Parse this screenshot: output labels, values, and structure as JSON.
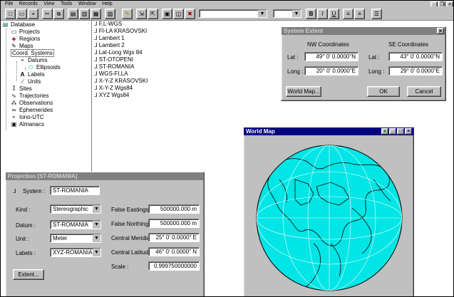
{
  "menu": [
    "File",
    "Records",
    "View",
    "Tools",
    "Window",
    "Help"
  ],
  "toolbar": {
    "buttons": [
      "new-icon",
      "open-icon",
      "save-icon",
      "cut-icon",
      "copy-icon",
      "paste-icon",
      "print-icon",
      "zoom-icon",
      "properties-icon",
      "edit-icon",
      "import-icon",
      "export-icon",
      "window-icon",
      "map-icon",
      "delete-icon",
      "bold-icon",
      "italic-icon",
      "underline-icon",
      "align-left-icon",
      "align-center-icon",
      "list-icon"
    ]
  },
  "tree": {
    "items": [
      "Database",
      "Projects",
      "Regions",
      "Maps",
      "Coord. Systems",
      "Datums",
      "Ellipsoids",
      "Labels",
      "Units",
      "Sites",
      "Trajectories",
      "Observations",
      "Ephemerides",
      "Iono-UTC",
      "Almanacs"
    ]
  },
  "coord_systems": [
    "F,L-WGS",
    "FI-LA KRASOVSKI",
    "Lambert 1",
    "Lambert 2",
    "Lat-Long Wgs 84",
    "ST-OTOPENI",
    "ST-ROMANIA",
    "WGS-FI,LA",
    "X-Y-Z KRASOVSKI",
    "X-Y-Z Wgs84",
    "XYZ Wgs84"
  ],
  "system_extent": {
    "title": "System Extent",
    "nw_header": "NW Coordinates",
    "se_header": "SE Coordinates",
    "lat_label": "Lat :",
    "long_label": "Long :",
    "nw_lat": "49° 0' 0.0000\"N",
    "nw_long": "20° 0' 0.0000\"E",
    "se_lat": "43° 0' 0.0000\"N",
    "se_long": "29° 0' 0.0000\"E",
    "world_map_btn": "World Map...",
    "ok_btn": "OK",
    "cancel_btn": "Cancel"
  },
  "world_map": {
    "title": "World Map"
  },
  "projection": {
    "title": "Projection [ST-ROMANIA]",
    "system_label": "System :",
    "system_value": "ST-ROMANIA",
    "kind_label": "Kind :",
    "kind_value": "Stereographic",
    "datum_label": "Datum :",
    "datum_value": "ST-ROMANIA",
    "unit_label": "Unit :",
    "unit_value": "Meter",
    "labels_label": "Labels :",
    "labels_value": "XYZ-ROMANIA",
    "false_eastings_label": "False Eastings :",
    "false_eastings_value": "500000.000 m",
    "false_northings_label": "False Northings :",
    "false_northings_value": "500000.000 m",
    "central_meridian_label": "Central Meridian :",
    "central_meridian_value": "25° 0' 0.0000\" E",
    "central_latitude_label": "Central Latitude :",
    "central_latitude_value": "46° 0' 0.0000\" N",
    "scale_label": "Scale :",
    "scale_value": "0.999750000000",
    "extent_btn": "Extent..."
  },
  "colors": {
    "titlebar_active": "#000080",
    "globe_ocean": "#00e5e5",
    "face": "#c0c0c0"
  }
}
